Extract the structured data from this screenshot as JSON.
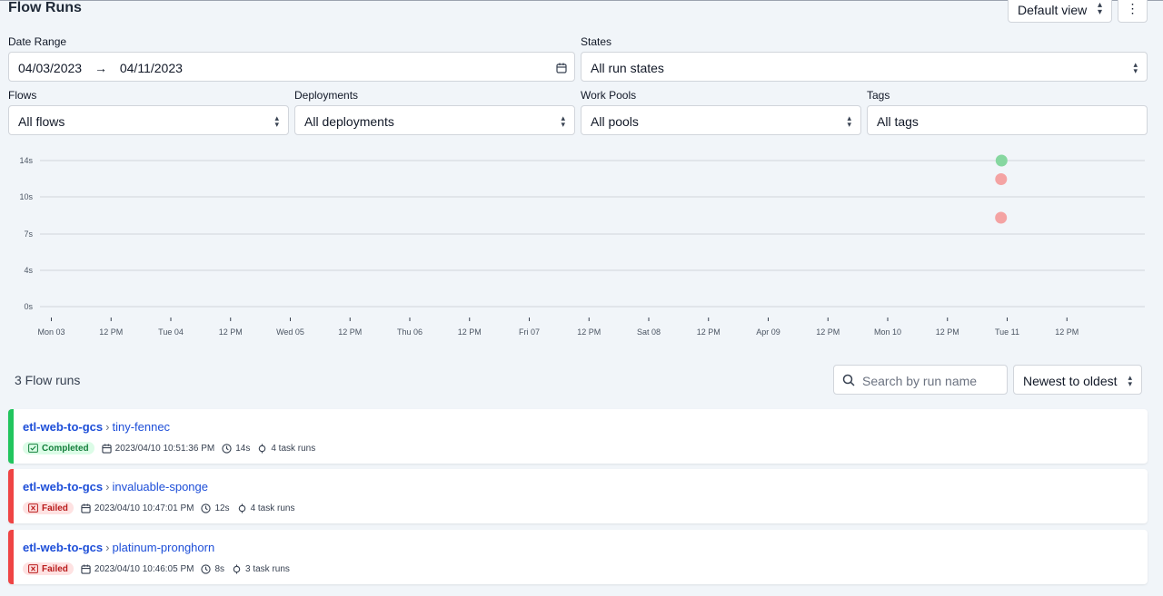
{
  "header": {
    "title": "Flow Runs",
    "view_label": "Default view",
    "more_label": "⋮"
  },
  "filters": {
    "date_range": {
      "label": "Date Range",
      "start": "04/03/2023",
      "arrow": "→",
      "end": "04/11/2023"
    },
    "states": {
      "label": "States",
      "value": "All run states"
    },
    "flows": {
      "label": "Flows",
      "value": "All flows"
    },
    "deployments": {
      "label": "Deployments",
      "value": "All deployments"
    },
    "work_pools": {
      "label": "Work Pools",
      "value": "All pools"
    },
    "tags": {
      "label": "Tags",
      "value": "All tags"
    }
  },
  "chart_data": {
    "type": "scatter",
    "ylabel": "",
    "xlabel": "",
    "y_ticks": [
      "14s",
      "10s",
      "7s",
      "4s",
      "0s"
    ],
    "x_ticks": [
      "Mon 03",
      "12 PM",
      "Tue 04",
      "12 PM",
      "Wed 05",
      "12 PM",
      "Thu 06",
      "12 PM",
      "Fri 07",
      "12 PM",
      "Sat 08",
      "12 PM",
      "Apr 09",
      "12 PM",
      "Mon 10",
      "12 PM",
      "Tue 11",
      "12 PM"
    ],
    "ylim": [
      0,
      14
    ],
    "grid": true,
    "points": [
      {
        "x": "2023/04/10 10:51:36 PM",
        "y": 14,
        "state": "Completed",
        "color": "#86d7a0"
      },
      {
        "x": "2023/04/10 10:47:01 PM",
        "y": 12,
        "state": "Failed",
        "color": "#f4a3a3"
      },
      {
        "x": "2023/04/10 10:46:05 PM",
        "y": 8,
        "state": "Failed",
        "color": "#f4a3a3"
      }
    ]
  },
  "list": {
    "count": "3 Flow runs",
    "search_placeholder": "Search by run name",
    "sort_label": "Newest to oldest",
    "runs": [
      {
        "flow": "etl-web-to-gcs",
        "name": "tiny-fennec",
        "state": "Completed",
        "time": "2023/04/10 10:51:36 PM",
        "duration": "14s",
        "tasks": "4 task runs"
      },
      {
        "flow": "etl-web-to-gcs",
        "name": "invaluable-sponge",
        "state": "Failed",
        "time": "2023/04/10 10:47:01 PM",
        "duration": "12s",
        "tasks": "4 task runs"
      },
      {
        "flow": "etl-web-to-gcs",
        "name": "platinum-pronghorn",
        "state": "Failed",
        "time": "2023/04/10 10:46:05 PM",
        "duration": "8s",
        "tasks": "3 task runs"
      }
    ]
  },
  "colors": {
    "completed": "#22c55e",
    "failed": "#ef4444",
    "link": "#1d4ed8"
  }
}
